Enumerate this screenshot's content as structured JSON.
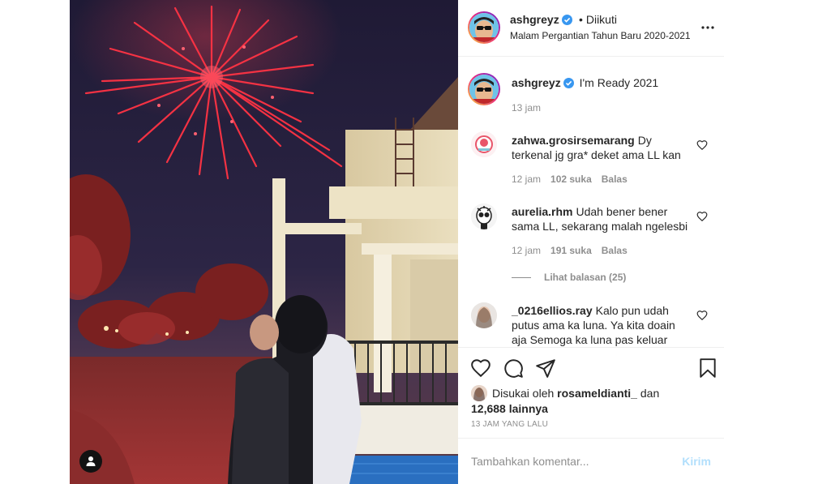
{
  "post": {
    "author": "ashgreyz",
    "follow_status": "Diikuti",
    "location": "Malam Pergantian Tahun Baru 2020-2021",
    "caption": "I'm Ready 2021",
    "caption_time": "13 jam"
  },
  "comments": [
    {
      "user": "zahwa.grosirsemarang",
      "text": "Dy terkenal jg gra* deket ama LL kan",
      "time": "12 jam",
      "likes": "102 suka",
      "reply_label": "Balas"
    },
    {
      "user": "aurelia.rhm",
      "text": "Udah bener bener sama LL, sekarang malah ngelesbi",
      "time": "12 jam",
      "likes": "191 suka",
      "reply_label": "Balas",
      "view_replies": "Lihat balasan (25)"
    },
    {
      "user": "_0216ellios.ray",
      "text": "Kalo pun udah putus ama ka luna. Ya kita doain aja Semoga ka luna pas keluar"
    }
  ],
  "likes": {
    "prefix": "Disukai oleh",
    "user": "rosameldianti_",
    "joiner": "dan",
    "count": "12,688 lainnya"
  },
  "timestamp": "13 JAM YANG LALU",
  "composer": {
    "placeholder": "Tambahkan komentar...",
    "send_label": "Kirim"
  },
  "colors": {
    "verified": "#3897f0",
    "send_disabled": "#b2dffc",
    "firework": "#ff3344"
  },
  "icons": [
    "user-tag-icon",
    "verified-badge-icon",
    "more-options-icon",
    "heart-icon",
    "comment-icon",
    "share-icon",
    "bookmark-icon"
  ]
}
